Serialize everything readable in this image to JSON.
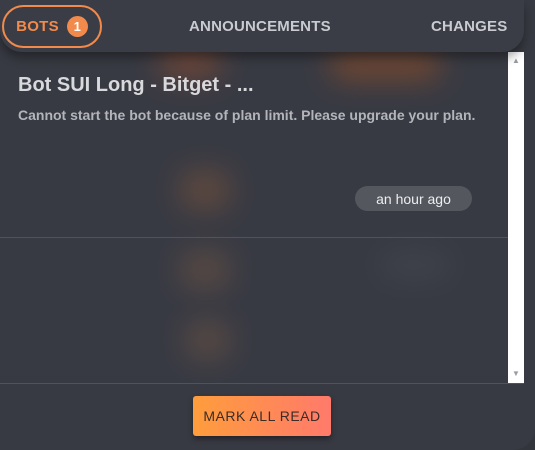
{
  "tabs": {
    "bots": {
      "label": "BOTS",
      "badge": "1"
    },
    "announcements": {
      "label": "ANNOUNCEMENTS"
    },
    "changes": {
      "label": "CHANGES"
    }
  },
  "notifications": [
    {
      "title": "Bot SUI Long - Bitget - ...",
      "body": "Cannot start the bot because of plan limit. Please upgrade your plan.",
      "time": "an hour ago"
    }
  ],
  "scrollbar": {
    "up_icon": "▲",
    "down_icon": "▼"
  },
  "footer": {
    "mark_all_read_label": "MARK ALL READ"
  },
  "colors": {
    "accent": "#f28a4b",
    "panel": "#383a43",
    "button_gradient_start": "#ff9d3c",
    "button_gradient_end": "#ff7a6b"
  }
}
